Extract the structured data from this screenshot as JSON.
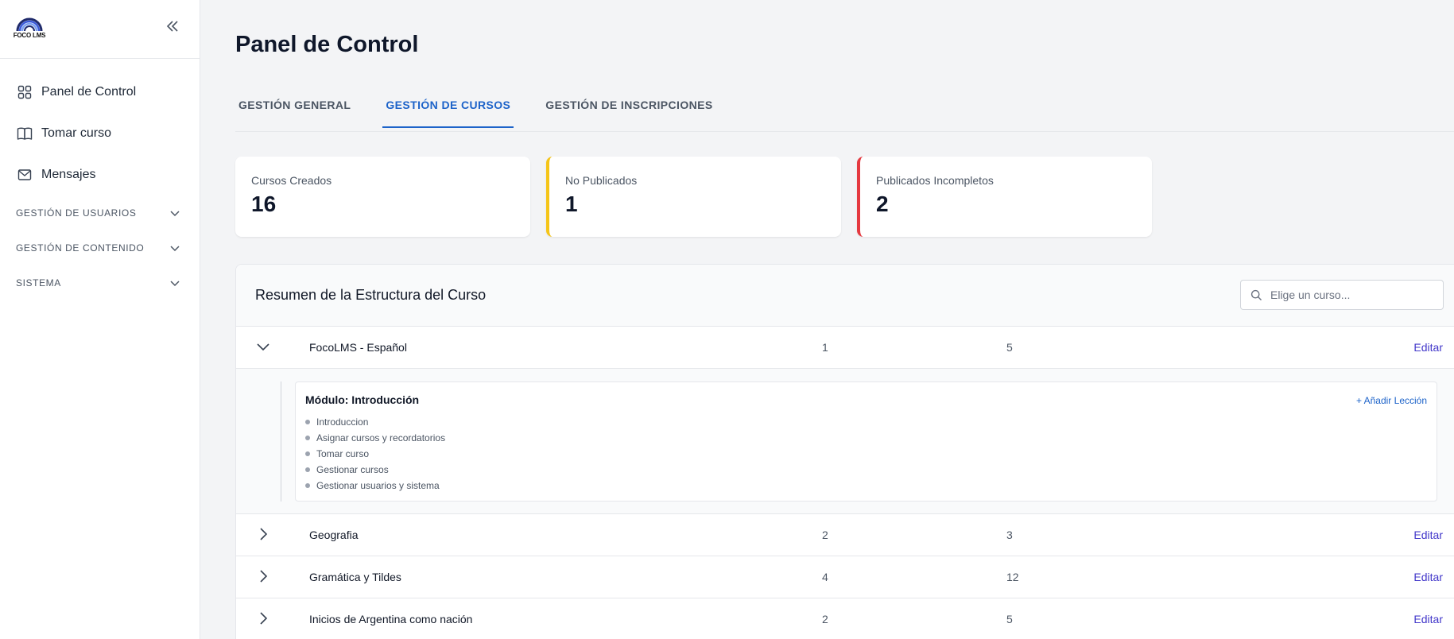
{
  "sidebar": {
    "logo_text": "FOCO LMS",
    "nav": [
      {
        "label": "Panel de Control",
        "icon": "grid-icon"
      },
      {
        "label": "Tomar curso",
        "icon": "book-icon"
      },
      {
        "label": "Mensajes",
        "icon": "mail-icon"
      }
    ],
    "sections": [
      {
        "label": "GESTIÓN DE USUARIOS"
      },
      {
        "label": "GESTIÓN DE CONTENIDO"
      },
      {
        "label": "SISTEMA"
      }
    ]
  },
  "main": {
    "title": "Panel de Control",
    "tabs": [
      {
        "label": "GESTIÓN GENERAL",
        "active": false
      },
      {
        "label": "GESTIÓN DE CURSOS",
        "active": true
      },
      {
        "label": "GESTIÓN DE INSCRIPCIONES",
        "active": false
      }
    ],
    "stats": [
      {
        "label": "Cursos Creados",
        "value": "16"
      },
      {
        "label": "No Publicados",
        "value": "1",
        "accent": "#f5c518"
      },
      {
        "label": "Publicados Incompletos",
        "value": "2",
        "accent": "#e53940"
      }
    ],
    "panel": {
      "title": "Resumen de la Estructura del Curso",
      "search_placeholder": "Elige un curso...",
      "edit_label": "Editar",
      "courses": [
        {
          "name": "FocoLMS - Español",
          "col1": "1",
          "col2": "5",
          "expanded": true
        },
        {
          "name": "Geografia",
          "col1": "2",
          "col2": "3"
        },
        {
          "name": "Gramática y Tildes",
          "col1": "4",
          "col2": "12"
        },
        {
          "name": "Inicios de Argentina como nación",
          "col1": "2",
          "col2": "5"
        }
      ],
      "module": {
        "title": "Módulo: Introducción",
        "add_label": "+ Añadir Lección",
        "lessons": [
          "Introduccion",
          "Asignar cursos y recordatorios",
          "Tomar curso",
          "Gestionar cursos",
          "Gestionar usuarios y sistema"
        ]
      }
    }
  }
}
